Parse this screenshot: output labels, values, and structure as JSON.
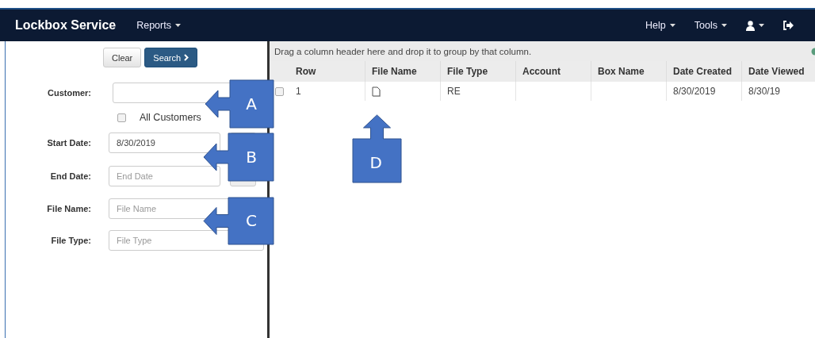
{
  "navbar": {
    "brand": "Lockbox Service",
    "left_menus": [
      {
        "label": "Reports"
      }
    ],
    "right_menus": [
      {
        "kind": "text",
        "label": "Help"
      },
      {
        "kind": "text",
        "label": "Tools"
      },
      {
        "kind": "user"
      },
      {
        "kind": "logout"
      }
    ]
  },
  "search_panel": {
    "buttons": [
      {
        "kind": "default",
        "label": "Clear"
      },
      {
        "kind": "primary",
        "label": "Search"
      }
    ],
    "fields": [
      {
        "kind": "text",
        "label": "Customer:"
      },
      {
        "kind": "checkbox",
        "label": "All Customers",
        "checked": false
      },
      {
        "kind": "date",
        "label": "Start Date:",
        "value": "8/30/2019"
      },
      {
        "kind": "date",
        "label": "End Date:",
        "placeholder": "End Date"
      },
      {
        "kind": "text",
        "label": "File Name:",
        "placeholder": "File Name"
      },
      {
        "kind": "text",
        "label": "File Type:",
        "placeholder": "File Type"
      }
    ]
  },
  "grid": {
    "group_hint": "Drag a column header here and drop it to group by that column.",
    "columns": [
      "Row",
      "File Name",
      "File Type",
      "Account",
      "Box Name",
      "Date Created",
      "Date Viewed"
    ],
    "rows": [
      {
        "checked": false,
        "cells": [
          {
            "kind": "text",
            "text": "1"
          },
          {
            "kind": "file"
          },
          {
            "kind": "text",
            "text": "RE"
          },
          {
            "kind": "empty"
          },
          {
            "kind": "empty"
          },
          {
            "kind": "text",
            "text": "8/30/2019"
          },
          {
            "kind": "text",
            "text": "8/30/19"
          }
        ]
      }
    ]
  },
  "callouts": [
    {
      "label": "A",
      "kind": "left"
    },
    {
      "label": "B",
      "kind": "left"
    },
    {
      "label": "C",
      "kind": "left"
    },
    {
      "label": "D",
      "kind": "up"
    }
  ]
}
